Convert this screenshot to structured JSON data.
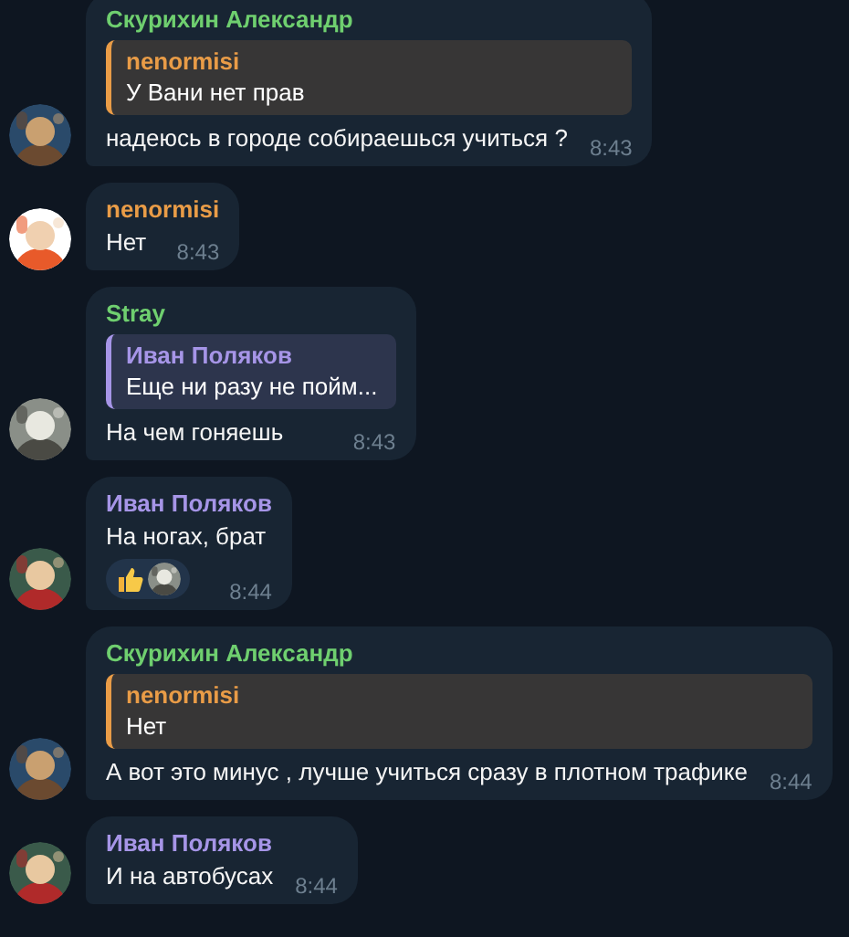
{
  "messages": [
    {
      "sender": {
        "name": "Скурихин Александр",
        "color": "#6fcf6f"
      },
      "reply": {
        "name": "nenormisi",
        "text": "У Вани нет прав",
        "color": "#e99c47"
      },
      "text": "надеюсь в городе собираешься учиться ?",
      "time": "8:43"
    },
    {
      "sender": {
        "name": "nenormisi",
        "color": "#e99c47"
      },
      "text": "Нет",
      "time": "8:43"
    },
    {
      "sender": {
        "name": "Stray",
        "color": "#6fcf6f"
      },
      "reply": {
        "name": "Иван Поляков",
        "text": "Еще ни разу не пойм...",
        "color": "#a695e7"
      },
      "text": "На чем гоняешь",
      "time": "8:43"
    },
    {
      "sender": {
        "name": "Иван Поляков",
        "color": "#a695e7"
      },
      "text": "На ногах, брат",
      "reacted": true,
      "time": "8:44"
    },
    {
      "sender": {
        "name": "Скурихин Александр",
        "color": "#6fcf6f"
      },
      "reply": {
        "name": "nenormisi",
        "text": "Нет",
        "color": "#e99c47"
      },
      "text": "А вот это минус , лучше учиться сразу в плотном трафике",
      "time": "8:44"
    },
    {
      "sender": {
        "name": "Иван Поляков",
        "color": "#a695e7"
      },
      "text": "И на автобусах",
      "time": "8:44"
    }
  ]
}
